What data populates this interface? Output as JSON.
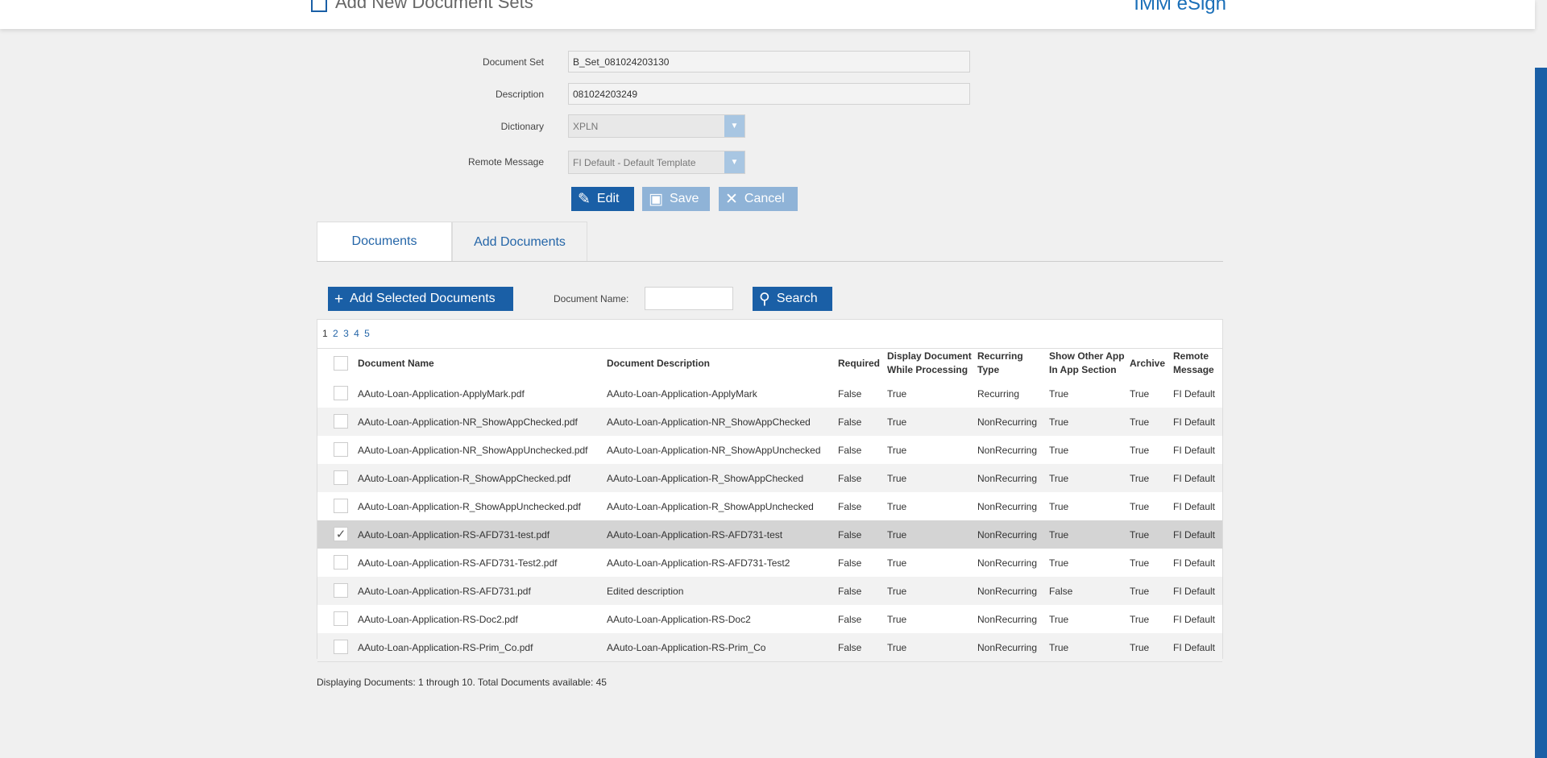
{
  "header": {
    "title": "Add New Document Sets",
    "brand": "IMM eSign"
  },
  "form": {
    "document_set_label": "Document Set",
    "document_set_value": "B_Set_081024203130",
    "description_label": "Description",
    "description_value": "081024203249",
    "dictionary_label": "Dictionary",
    "dictionary_value": "XPLN",
    "remote_message_label": "Remote Message",
    "remote_message_value": "FI Default - Default Template"
  },
  "actions": {
    "edit": "Edit",
    "save": "Save",
    "cancel": "Cancel"
  },
  "tabs": [
    {
      "label": "Documents"
    },
    {
      "label": "Add Documents"
    }
  ],
  "toolbar": {
    "add_selected": "Add Selected Documents",
    "document_name_label": "Document Name:",
    "document_name_value": "",
    "search": "Search"
  },
  "pagination": [
    "1",
    "2",
    "3",
    "4",
    "5"
  ],
  "columns": {
    "name": "Document Name",
    "description": "Document Description",
    "required": "Required",
    "display_line1": "Display Document",
    "display_line2": "While Processing",
    "recurring_line1": "Recurring",
    "recurring_line2": "Type",
    "show_other_line1": "Show Other App",
    "show_other_line2": "In App Section",
    "archive": "Archive",
    "remote_line1": "Remote",
    "remote_line2": "Message"
  },
  "rows": [
    {
      "checked": false,
      "name": "AAuto-Loan-Application-ApplyMark.pdf",
      "description": "AAuto-Loan-Application-ApplyMark",
      "required": "False",
      "display": "True",
      "recurring": "Recurring",
      "show_other": "True",
      "archive": "True",
      "remote": "FI Default"
    },
    {
      "checked": false,
      "name": "AAuto-Loan-Application-NR_ShowAppChecked.pdf",
      "description": "AAuto-Loan-Application-NR_ShowAppChecked",
      "required": "False",
      "display": "True",
      "recurring": "NonRecurring",
      "show_other": "True",
      "archive": "True",
      "remote": "FI Default"
    },
    {
      "checked": false,
      "name": "AAuto-Loan-Application-NR_ShowAppUnchecked.pdf",
      "description": "AAuto-Loan-Application-NR_ShowAppUnchecked",
      "required": "False",
      "display": "True",
      "recurring": "NonRecurring",
      "show_other": "True",
      "archive": "True",
      "remote": "FI Default"
    },
    {
      "checked": false,
      "name": "AAuto-Loan-Application-R_ShowAppChecked.pdf",
      "description": "AAuto-Loan-Application-R_ShowAppChecked",
      "required": "False",
      "display": "True",
      "recurring": "NonRecurring",
      "show_other": "True",
      "archive": "True",
      "remote": "FI Default"
    },
    {
      "checked": false,
      "name": "AAuto-Loan-Application-R_ShowAppUnchecked.pdf",
      "description": "AAuto-Loan-Application-R_ShowAppUnchecked",
      "required": "False",
      "display": "True",
      "recurring": "NonRecurring",
      "show_other": "True",
      "archive": "True",
      "remote": "FI Default"
    },
    {
      "checked": true,
      "name": "AAuto-Loan-Application-RS-AFD731-test.pdf",
      "description": "AAuto-Loan-Application-RS-AFD731-test",
      "required": "False",
      "display": "True",
      "recurring": "NonRecurring",
      "show_other": "True",
      "archive": "True",
      "remote": "FI Default"
    },
    {
      "checked": false,
      "name": "AAuto-Loan-Application-RS-AFD731-Test2.pdf",
      "description": "AAuto-Loan-Application-RS-AFD731-Test2",
      "required": "False",
      "display": "True",
      "recurring": "NonRecurring",
      "show_other": "True",
      "archive": "True",
      "remote": "FI Default"
    },
    {
      "checked": false,
      "name": "AAuto-Loan-Application-RS-AFD731.pdf",
      "description": "Edited description",
      "required": "False",
      "display": "True",
      "recurring": "NonRecurring",
      "show_other": "False",
      "archive": "True",
      "remote": "FI Default"
    },
    {
      "checked": false,
      "name": "AAuto-Loan-Application-RS-Doc2.pdf",
      "description": "AAuto-Loan-Application-RS-Doc2",
      "required": "False",
      "display": "True",
      "recurring": "NonRecurring",
      "show_other": "True",
      "archive": "True",
      "remote": "FI Default"
    },
    {
      "checked": false,
      "name": "AAuto-Loan-Application-RS-Prim_Co.pdf",
      "description": "AAuto-Loan-Application-RS-Prim_Co",
      "required": "False",
      "display": "True",
      "recurring": "NonRecurring",
      "show_other": "True",
      "archive": "True",
      "remote": "FI Default"
    }
  ],
  "footer": "Displaying Documents: 1 through 10. Total Documents available: 45"
}
